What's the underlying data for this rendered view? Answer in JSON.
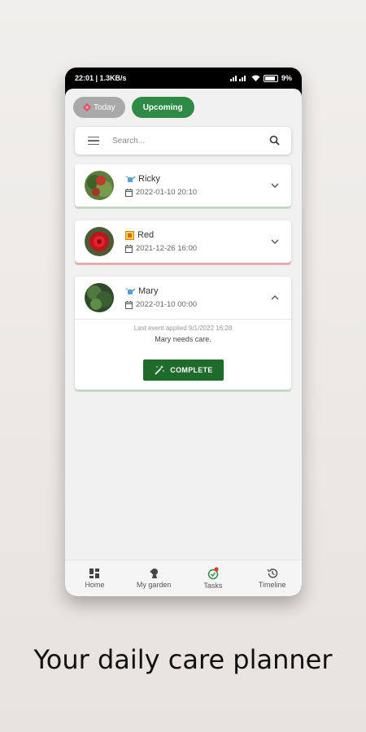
{
  "status_bar": {
    "time_info": "22:01 | 1.3KB/s",
    "battery": "9%"
  },
  "tabs": {
    "today": "Today",
    "upcoming": "Upcoming"
  },
  "search": {
    "placeholder": "Search..."
  },
  "cards": [
    {
      "name": "Ricky",
      "date": "2022-01-10 20:10",
      "accent": "#cfe6d3",
      "expanded": false
    },
    {
      "name": "Red",
      "date": "2021-12-26 16:00",
      "accent": "#f3b8b8",
      "expanded": false
    },
    {
      "name": "Mary",
      "date": "2022-01-10 00:00",
      "accent": "#cfe6d3",
      "expanded": true,
      "last_event": "Last event applied 9/1/2022 16:28",
      "message": "Mary needs care.",
      "complete_label": "COMPLETE"
    }
  ],
  "nav": {
    "home": "Home",
    "garden": "My garden",
    "tasks": "Tasks",
    "timeline": "Timeline"
  },
  "colors": {
    "primary": "#2e8b46",
    "dark_green": "#1f6b2c",
    "badge": "#e53935"
  },
  "tagline": "Your daily care planner"
}
